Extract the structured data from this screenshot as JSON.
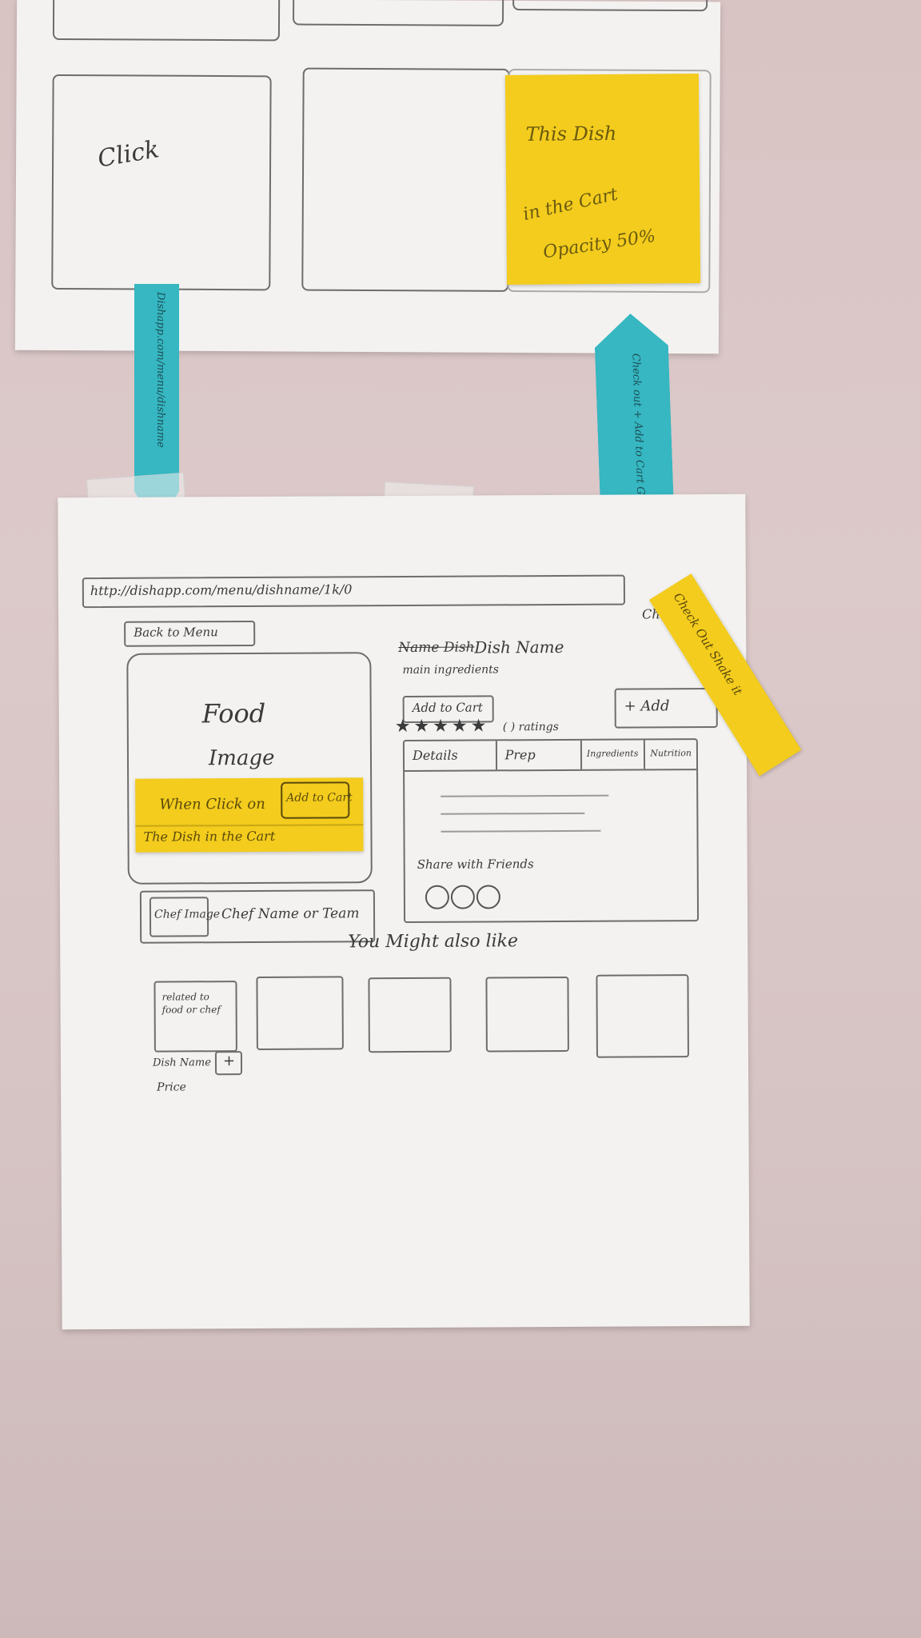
{
  "top_sketch": {
    "tile_click_label": "Click",
    "sticky_note": {
      "line1": "This Dish",
      "line2": "in the Cart",
      "line3": "Opacity 50%"
    }
  },
  "arrows": {
    "left_arrow_text": "Dishapp.com/menu/dishname",
    "right_arrow_text": "Check out + Add to Cart Go back to Menu"
  },
  "wireframe": {
    "url": "http://dishapp.com/menu/dishname/1k/0",
    "back_link": "Back to Menu",
    "food_image_line1": "Food",
    "food_image_line2": "Image",
    "sticky_click_text": "When Click on",
    "sticky_button_label": "Add to Cart",
    "sticky_result_text": "The Dish in the Cart",
    "chef_image_label": "Chef Image",
    "chef_name_label": "Chef Name or Team",
    "dish_name_struck": "Name Dish",
    "dish_name": "Dish Name",
    "main_ingredients": "main ingredients",
    "rating_stars": "★★★★★",
    "ratings_count": "( ) ratings",
    "add_cart_label": "Add to Cart",
    "add_button_label": "+ Add",
    "checkout_label": "Checkout",
    "diagonal_sticky_text": "Check Out Shake it",
    "tabs": [
      "Details",
      "Prep",
      "Ingredients",
      "Nutrition"
    ],
    "share_text": "Share with Friends",
    "might_like_heading": "You Might also like",
    "related_text": "related to food or chef",
    "dish_name_label": "Dish Name",
    "price_label": "Price",
    "plus_label": "+"
  },
  "colors": {
    "wall": "#d9c4c4",
    "paper": "#f3f2f0",
    "sticky_yellow": "#f3cc1d",
    "arrow_cyan": "#36b7c2",
    "pencil": "#3a3a3a"
  }
}
